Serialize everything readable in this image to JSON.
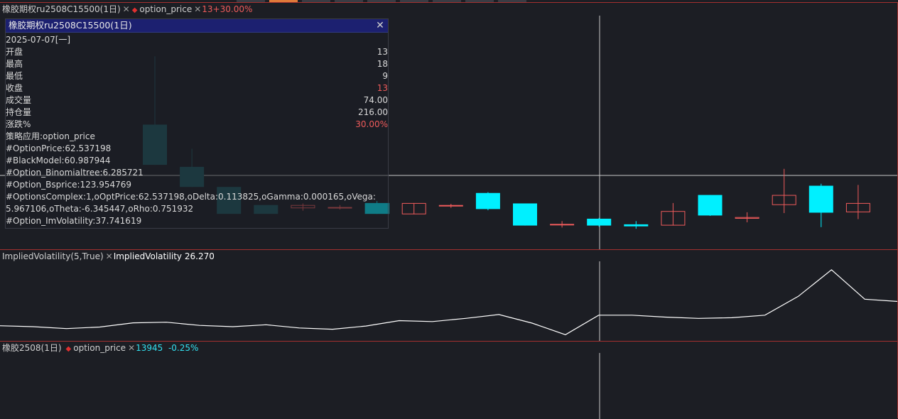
{
  "price_pane": {
    "symbol_label": "橡胶期权ru2508C15500(1日)",
    "indicator_label": "option_price",
    "value_label": "13+30.00%"
  },
  "iv_pane": {
    "indicator_label": "ImpliedVolatility(5,True)",
    "series_label": "ImpliedVolatility",
    "series_value": "26.270"
  },
  "underlying_pane": {
    "symbol_label": "橡胶2508(1日)",
    "indicator_label": "option_price",
    "price": "13945",
    "change": "-0.25%"
  },
  "popup": {
    "title": "橡胶期权ru2508C15500(1日)",
    "date": "2025-07-07[一]",
    "fields": [
      {
        "label": "开盘",
        "value": "13"
      },
      {
        "label": "最高",
        "value": "18"
      },
      {
        "label": "最低",
        "value": "9"
      },
      {
        "label": "收盘",
        "value": "13",
        "red": true
      },
      {
        "label": "成交量",
        "value": "74.00"
      },
      {
        "label": "持仓量",
        "value": "216.00"
      },
      {
        "label": "涨跌%",
        "value": "30.00%",
        "red": true
      }
    ],
    "lines": [
      "策略应用:option_price",
      "#OptionPrice:62.537198",
      "#BlackModel:60.987944",
      "#Option_Binomialtree:6.285721",
      "#Option_Bsprice:123.954769",
      "#OptionsComplex:1,oOptPrice:62.537198,oDelta:0.113825,oGamma:0.000165,oVega:",
      "5.967106,oTheta:-6.345447,oRho:0.751932",
      "#Option_ImVolatility:37.741619"
    ]
  },
  "colors": {
    "up": "#ef5b5b",
    "down": "#00f0ff",
    "down_dim": "#1d5a60",
    "iv_line": "#ffffff",
    "crosshair": "#c8c8c8",
    "border": "#a3302f"
  },
  "chart_data": [
    {
      "type": "candlestick",
      "title": "橡胶期权ru2508C15500(1日)",
      "candles": [
        {
          "open": 25.0,
          "high": 42.0,
          "low": 15.0,
          "close": 15.0
        },
        {
          "open": 14.5,
          "high": 19.0,
          "low": 9.5,
          "close": 9.5
        },
        {
          "open": 9.5,
          "high": 9.5,
          "low": 2.8,
          "close": 2.8
        },
        {
          "open": 5.0,
          "high": 5.0,
          "low": 2.8,
          "close": 2.8
        },
        {
          "open": 4.2,
          "high": 5.4,
          "low": 3.6,
          "close": 5.0
        },
        {
          "open": 4.5,
          "high": 5.0,
          "low": 3.9,
          "close": 4.5
        },
        {
          "open": 5.5,
          "high": 6.0,
          "low": 2.8,
          "close": 2.8
        },
        {
          "open": 2.7,
          "high": 5.5,
          "low": 2.7,
          "close": 5.5
        },
        {
          "open": 4.7,
          "high": 5.3,
          "low": 4.3,
          "close": 5.0
        },
        {
          "open": 8.0,
          "high": 8.2,
          "low": 3.7,
          "close": 4.0
        },
        {
          "open": 5.4,
          "high": 5.4,
          "low": -0.1,
          "close": -0.1
        },
        {
          "open": 0.3,
          "high": 1.0,
          "low": -0.6,
          "close": 0.3
        },
        {
          "open": 1.6,
          "high": 1.8,
          "low": -0.4,
          "close": -0.1
        },
        {
          "open": 0.2,
          "high": 1.0,
          "low": -0.9,
          "close": -0.3
        },
        {
          "open": -0.1,
          "high": 5.5,
          "low": -0.1,
          "close": 3.5
        },
        {
          "open": 7.5,
          "high": 7.5,
          "low": 2.3,
          "close": 2.4
        },
        {
          "open": 1.6,
          "high": 3.2,
          "low": 0.7,
          "close": 2.0
        },
        {
          "open": 5.0,
          "high": 14.0,
          "low": 3.0,
          "close": 7.5
        },
        {
          "open": 9.8,
          "high": 10.3,
          "low": -0.5,
          "close": 3.1
        },
        {
          "open": 3.2,
          "high": 10.0,
          "low": 1.5,
          "close": 5.5
        }
      ],
      "ylim": [
        -3,
        50
      ]
    },
    {
      "type": "line",
      "title": "ImpliedVolatility(5,True)",
      "series": [
        {
          "name": "ImpliedVolatility",
          "values": [
            24.3,
            24.0,
            23.4,
            23.9,
            25.2,
            25.4,
            24.4,
            24.0,
            24.6,
            23.6,
            23.2,
            24.2,
            25.9,
            25.6,
            26.6,
            27.8,
            25.1,
            21.5,
            27.6,
            27.6,
            27.0,
            26.6,
            26.8,
            27.6,
            33.5,
            41.8,
            32.6,
            31.9
          ]
        }
      ],
      "ylim": [
        20,
        44
      ]
    }
  ]
}
